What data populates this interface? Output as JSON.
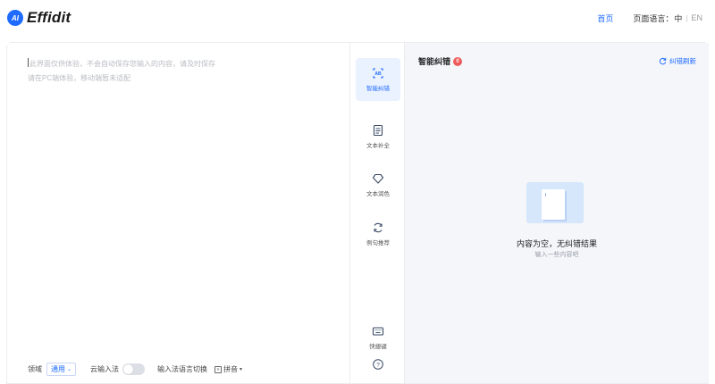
{
  "header": {
    "logo_mark": "AI",
    "logo_text": "Effidit",
    "nav_home": "首页",
    "lang_label": "页面语言：",
    "lang_current": "中",
    "lang_other": "EN"
  },
  "editor": {
    "placeholder_line1": "此界面仅供体验，不会自动保存您输入的内容，请及时保存",
    "placeholder_line2": "请在PC端体验，移动端暂未适配",
    "domain_label": "领域",
    "domain_value": "通用",
    "cloud_ime_label": "云输入法",
    "cloud_ime_on": false,
    "ime_switch_label": "输入法语言切换",
    "ime_value": "拼音"
  },
  "tools": [
    {
      "label": "智能纠错",
      "icon": "ab-check-icon",
      "active": true
    },
    {
      "label": "文本补全",
      "icon": "document-list-icon",
      "active": false
    },
    {
      "label": "文本润色",
      "icon": "diamond-icon",
      "active": false
    },
    {
      "label": "例句推荐",
      "icon": "refresh-cycle-icon",
      "active": false
    },
    {
      "label": "快捷键",
      "icon": "keyboard-icon",
      "active": false
    },
    {
      "icon": "help-icon"
    }
  ],
  "result": {
    "title": "智能纠错",
    "badge": "0",
    "refresh_label": "纠错刷新",
    "empty_title": "内容为空，无纠错结果",
    "empty_sub": "输入一些内容吧"
  },
  "colors": {
    "accent": "#1f6bff",
    "active_bg": "#eaf1ff",
    "panel_bg": "#f4f6fa",
    "badge": "#ef5a5a"
  }
}
